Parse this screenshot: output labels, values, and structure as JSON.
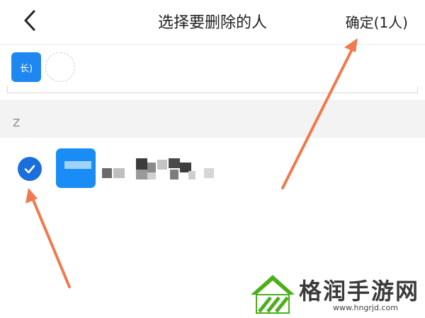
{
  "header": {
    "title": "选择要删除的人",
    "confirm_label": "确定(1人)"
  },
  "selected": {
    "chip_label": "长)"
  },
  "section": {
    "letter": "Z"
  },
  "contact": {
    "checked": true
  },
  "watermark": {
    "name": "格润手游网",
    "url": "www.hngrjd.com"
  },
  "colors": {
    "accent": "#1a6fdc",
    "arrow": "#f07a4d",
    "watermark_green": "#4caf1a"
  },
  "icons": {
    "back": "chevron-left-icon",
    "check": "checkmark-icon"
  }
}
